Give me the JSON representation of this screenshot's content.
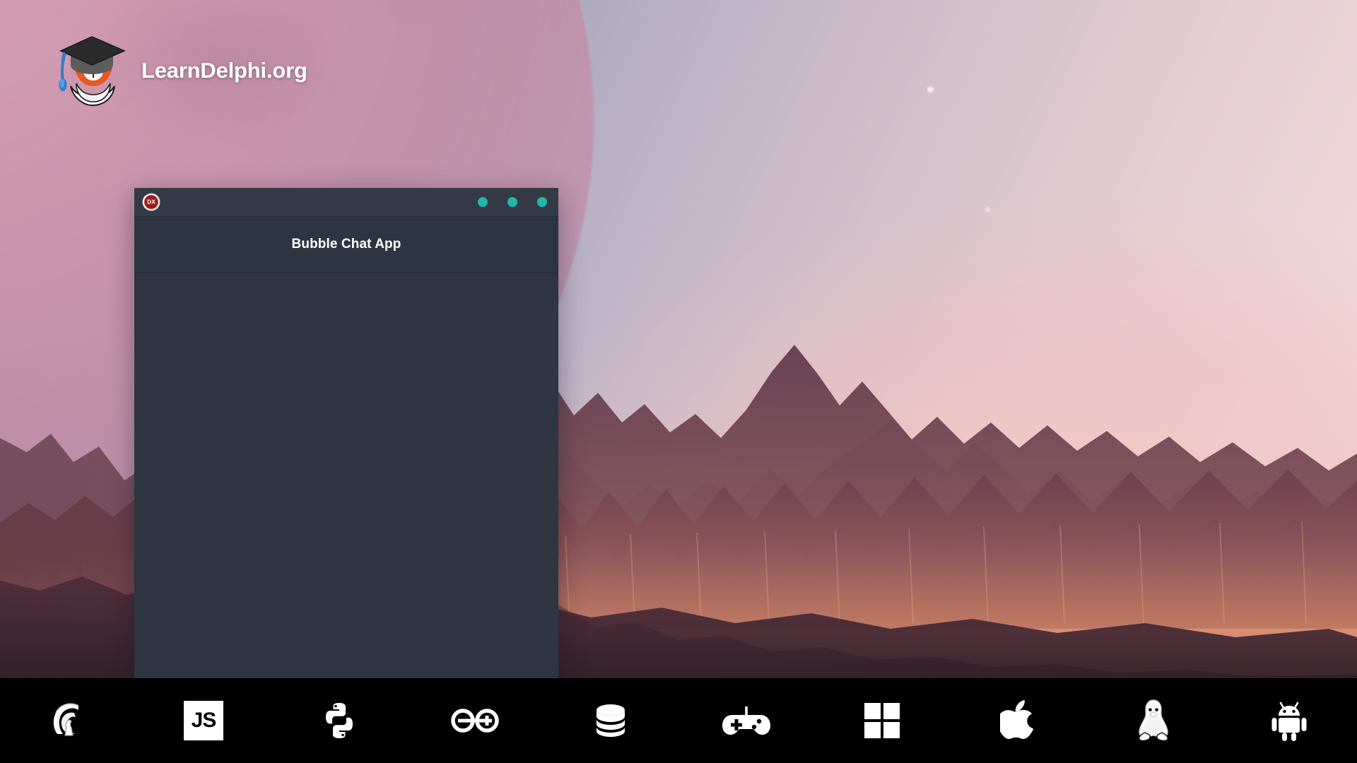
{
  "brand": {
    "name": "LearnDelphi.org",
    "logo_icon": "delphi-tiger-graduate-logo"
  },
  "desktop": {
    "wallpaper_description": "Martian landscape with jagged rock spires, orange desert floor, pink sky and large pink planet",
    "colors": {
      "sky_top_left": "#8d93ab",
      "sky_right": "#f4dcdb",
      "planet": "#d496ac",
      "desert": "#df8e72",
      "rock_dark": "#6b3f4a",
      "rock_light": "#c98a78",
      "taskbar": "#000000"
    }
  },
  "window": {
    "title": "Bubble Chat App",
    "titlebar_icon": "dx-delphi-icon",
    "controls": [
      {
        "name": "minimize",
        "label": "",
        "color": "#21b6ae"
      },
      {
        "name": "maximize",
        "label": "",
        "color": "#21b6ae"
      },
      {
        "name": "close",
        "label": "",
        "color": "#21b6ae"
      }
    ],
    "colors": {
      "titlebar": "#343b47",
      "header": "#2e3542",
      "body": "#2f3541",
      "accent": "#21b6ae",
      "title_text": "#ffffff"
    },
    "body_content": ""
  },
  "taskbar": {
    "items": [
      {
        "id": "delphi",
        "icon": "spartan-helmet-icon",
        "label": "Delphi"
      },
      {
        "id": "javascript",
        "icon": "javascript-icon",
        "label": "JS"
      },
      {
        "id": "python",
        "icon": "python-icon",
        "label": "Python"
      },
      {
        "id": "arduino",
        "icon": "arduino-infinity-icon",
        "label": "Arduino"
      },
      {
        "id": "database",
        "icon": "database-stack-icon",
        "label": "Database"
      },
      {
        "id": "gaming",
        "icon": "gamepad-icon",
        "label": "Gaming"
      },
      {
        "id": "windows",
        "icon": "windows-logo-icon",
        "label": "Windows"
      },
      {
        "id": "apple",
        "icon": "apple-logo-icon",
        "label": "macOS"
      },
      {
        "id": "linux",
        "icon": "linux-tux-icon",
        "label": "Linux"
      },
      {
        "id": "android",
        "icon": "android-robot-icon",
        "label": "Android"
      }
    ]
  }
}
